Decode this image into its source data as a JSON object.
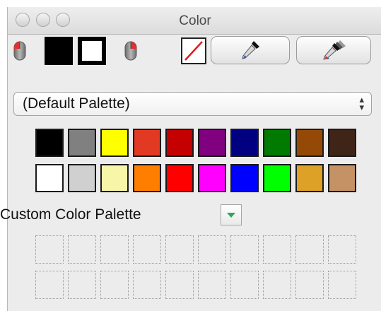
{
  "window": {
    "title": "Color"
  },
  "toolbar": {
    "fill_color": "#000000",
    "stroke_color": "#000000",
    "no_color_stroke": "#e21b1b",
    "icons": [
      "left-mouse-icon",
      "fill-swatch",
      "stroke-swatch",
      "right-mouse-icon",
      "no-color-icon",
      "eyedropper-icon",
      "multi-eyedropper-icon"
    ]
  },
  "palette_select": {
    "value": "(Default Palette)"
  },
  "palette": {
    "rows": [
      [
        "#000000",
        "#808080",
        "#ffff00",
        "#e23a22",
        "#c40000",
        "#800080",
        "#000080",
        "#007a00",
        "#944a06",
        "#3f2418"
      ],
      [
        "#ffffff",
        "#d0d0d0",
        "#f7f6a8",
        "#ff7e00",
        "#ff0000",
        "#ff00ff",
        "#0000ff",
        "#00ff00",
        "#dca126",
        "#c49264"
      ]
    ]
  },
  "custom_palette": {
    "label": "Custom Color Palette",
    "empty_rows": 2,
    "empty_cols": 10
  }
}
